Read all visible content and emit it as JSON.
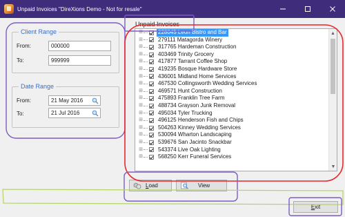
{
  "window": {
    "title": "Unpaid Invoices \"DireXions Demo - Not for resale\"",
    "controls": {
      "minimize": "—",
      "maximize": "☐",
      "close": "✕"
    }
  },
  "client_range": {
    "legend": "Client Range",
    "from_label": "From:",
    "from_value": "000000",
    "to_label": "To:",
    "to_value": "999999"
  },
  "date_range": {
    "legend": "Date Range",
    "from_label": "From:",
    "from_value": "21 May 2016",
    "to_label": "To:",
    "to_value": "21 Jul 2016"
  },
  "invoices": {
    "header": "Unpaid Invoices",
    "items": [
      {
        "text": "228045 Leon Bistro and Bar",
        "selected": true
      },
      {
        "text": "279111 Matagorda Winery",
        "selected": false
      },
      {
        "text": "317765 Hardeman Construction",
        "selected": false
      },
      {
        "text": "403469 Trinity Grocery",
        "selected": false
      },
      {
        "text": "417877 Tarrant Coffee Shop",
        "selected": false
      },
      {
        "text": "419235 Bosque Hardware Store",
        "selected": false
      },
      {
        "text": "436001 Midland Home Services",
        "selected": false
      },
      {
        "text": "467530 Collingsworth Wedding Services",
        "selected": false
      },
      {
        "text": "469571 Hunt Construction",
        "selected": false
      },
      {
        "text": "475893 Franklin Tree Farm",
        "selected": false
      },
      {
        "text": "488734 Grayson Junk Removal",
        "selected": false
      },
      {
        "text": "495034 Tyler Trucking",
        "selected": false
      },
      {
        "text": "496125 Henderson Fish and Chips",
        "selected": false
      },
      {
        "text": "504263 Kinney Wedding Services",
        "selected": false
      },
      {
        "text": "530094 Wharton Landscaping",
        "selected": false
      },
      {
        "text": "539676 San Jacinto Snackbar",
        "selected": false
      },
      {
        "text": "543374 Live Oak Lighting",
        "selected": false
      },
      {
        "text": "568250 Kerr Funeral Services",
        "selected": false
      }
    ]
  },
  "buttons": {
    "load_underline": "L",
    "load_rest": "oad",
    "view": "View",
    "exit_underline": "E",
    "exit_rest": "xit"
  },
  "colors": {
    "titlebar": "#3f2c7a",
    "legend": "#3a6fc4",
    "selection": "#3399ff",
    "annotation_purple": "#7b5cc4",
    "annotation_red": "#e8262b",
    "annotation_green": "#b5d56a"
  },
  "icons": {
    "app": "app-icon",
    "calendar": "magnifier-icon",
    "load": "load-icon",
    "view": "magnifier-icon"
  }
}
